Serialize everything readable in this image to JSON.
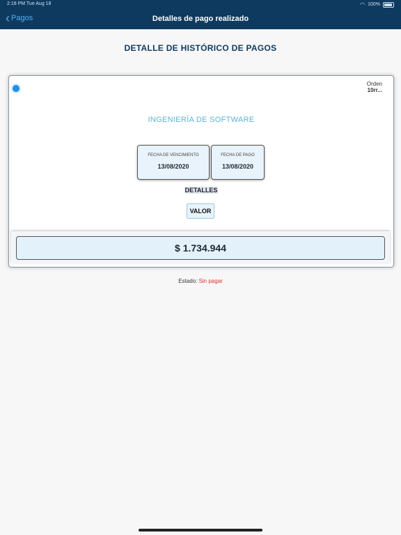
{
  "status_bar": {
    "time": "2:18 PM",
    "date": "Tue Aug 18",
    "battery": "100%"
  },
  "nav": {
    "back_label": "Pagos",
    "title": "Detalles de pago realizado"
  },
  "page": {
    "heading": "DETALLE DE HISTÓRICO DE PAGOS"
  },
  "card": {
    "orden_label": "Orden",
    "orden_value": "10rr...",
    "subject": "INGENIERÍA DE SOFTWARE",
    "fecha_vencimiento_label": "FECHA DE VENCIMIENTO",
    "fecha_vencimiento_value": "13/08/2020",
    "fecha_pago_label": "FECHA DE PAGO",
    "fecha_pago_value": "13/08/2020",
    "detalles_label": "DETALLES",
    "valor_label": "VALOR",
    "amount": "$ 1.734.944"
  },
  "estado": {
    "label": "Estado:",
    "value": "Sin pagar"
  },
  "colors": {
    "nav_bg": "#0f3a5f",
    "accent": "#4fb3f4",
    "unpaid": "#e03030"
  }
}
